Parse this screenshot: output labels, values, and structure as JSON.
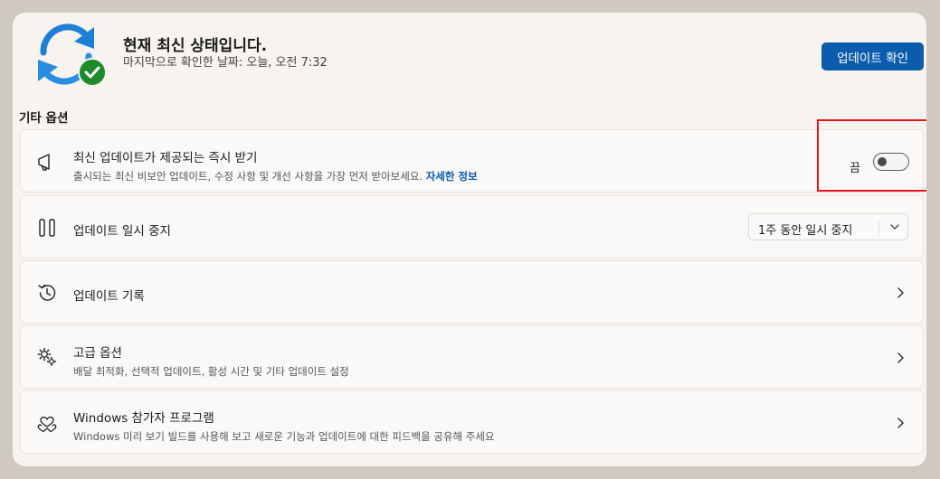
{
  "header": {
    "title": "현재 최신 상태입니다.",
    "last_checked": "마지막으로 확인한 날짜: 오늘, 오전 7:32",
    "check_button": "업데이트 확인",
    "icon": "sync-check-icon"
  },
  "section": {
    "heading": "기타 옵션"
  },
  "cards": {
    "latest_updates": {
      "title": "최신 업데이트가 제공되는 즉시 받기",
      "desc": "출시되는 최신 비보안 업데이트, 수정 사항 및 개선 사항을 가장 먼저 받아보세요.",
      "link": "자세한 정보",
      "toggle_label": "끔",
      "toggle_on": false,
      "icon": "megaphone-icon"
    },
    "pause": {
      "title": "업데이트 일시 중지",
      "dropdown_value": "1주 동안 일시 중지",
      "icon": "pause-icon"
    },
    "history": {
      "title": "업데이트 기록",
      "icon": "history-icon"
    },
    "advanced": {
      "title": "고급 옵션",
      "desc": "배달 최적화, 선택적 업데이트, 활성 시간 및 기타 업데이트 설정",
      "icon": "gears-icon"
    },
    "insider": {
      "title": "Windows 참가자 프로그램",
      "desc": "Windows 미리 보기 빌드를 사용해 보고 새로운 기능과 업데이트에 대한 피드백을 공유해 주세요",
      "icon": "insider-hearts-icon"
    }
  },
  "colors": {
    "accent": "#0b5cad",
    "highlight_box": "#e8141b",
    "check_badge": "#1f8a2a",
    "sync_arrows": "#1f7fd6"
  }
}
